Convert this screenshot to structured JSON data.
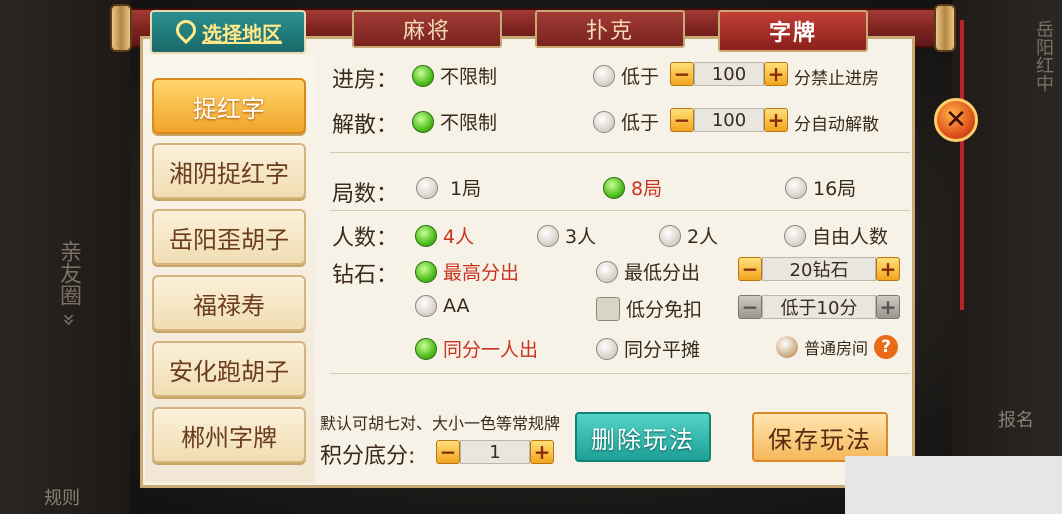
{
  "region": {
    "label": "选择地区"
  },
  "tabs": [
    {
      "label": "麻将",
      "active": false
    },
    {
      "label": "扑克",
      "active": false
    },
    {
      "label": "字牌",
      "active": true
    }
  ],
  "sidebar": {
    "items": [
      {
        "label": "捉红字",
        "active": true
      },
      {
        "label": "湘阴捉红字",
        "active": false
      },
      {
        "label": "岳阳歪胡子",
        "active": false
      },
      {
        "label": "福禄寿",
        "active": false
      },
      {
        "label": "安化跑胡子",
        "active": false
      },
      {
        "label": "郴州字牌",
        "active": false
      }
    ]
  },
  "entry": {
    "label": "进房：",
    "opt_unlimited": "不限制",
    "opt_below": "低于",
    "value": "100",
    "suffix": "分禁止进房",
    "selected": "unlimited"
  },
  "dissolve": {
    "label": "解散：",
    "opt_unlimited": "不限制",
    "opt_below": "低于",
    "value": "100",
    "suffix": "分自动解散",
    "selected": "unlimited"
  },
  "rounds": {
    "label": "局数：",
    "options": [
      "1局",
      "8局",
      "16局"
    ],
    "selected": "8局"
  },
  "players": {
    "label": "人数：",
    "options": [
      "4人",
      "3人",
      "2人",
      "自由人数"
    ],
    "selected": "4人"
  },
  "diamonds": {
    "label": "钻石：",
    "opt_highest": "最高分出",
    "opt_lowest": "最低分出",
    "stepper_value": "20钻石",
    "opt_aa": "AA",
    "opt_low_free": "低分免扣",
    "low_stepper_value": "低于10分",
    "opt_same_one": "同分一人出",
    "opt_same_split": "同分平摊",
    "room_type": "普通房间",
    "selected": "最高分出"
  },
  "rules_note": "默认可胡七对、大小一色等常规牌",
  "base_score": {
    "label": "积分底分:",
    "value": "1"
  },
  "buttons": {
    "delete": "删除玩法",
    "save": "保存玩法"
  },
  "close_symbol": "✕",
  "help_symbol": "?",
  "background": {
    "left_text": "亲友圈 »",
    "right_top_text": "岳阳红中",
    "bottom_left": "规则",
    "right_signup": "报名"
  },
  "colors": {
    "accent_red": "#c9341f",
    "teal": "#1ea097",
    "gold": "#f0a52a"
  }
}
